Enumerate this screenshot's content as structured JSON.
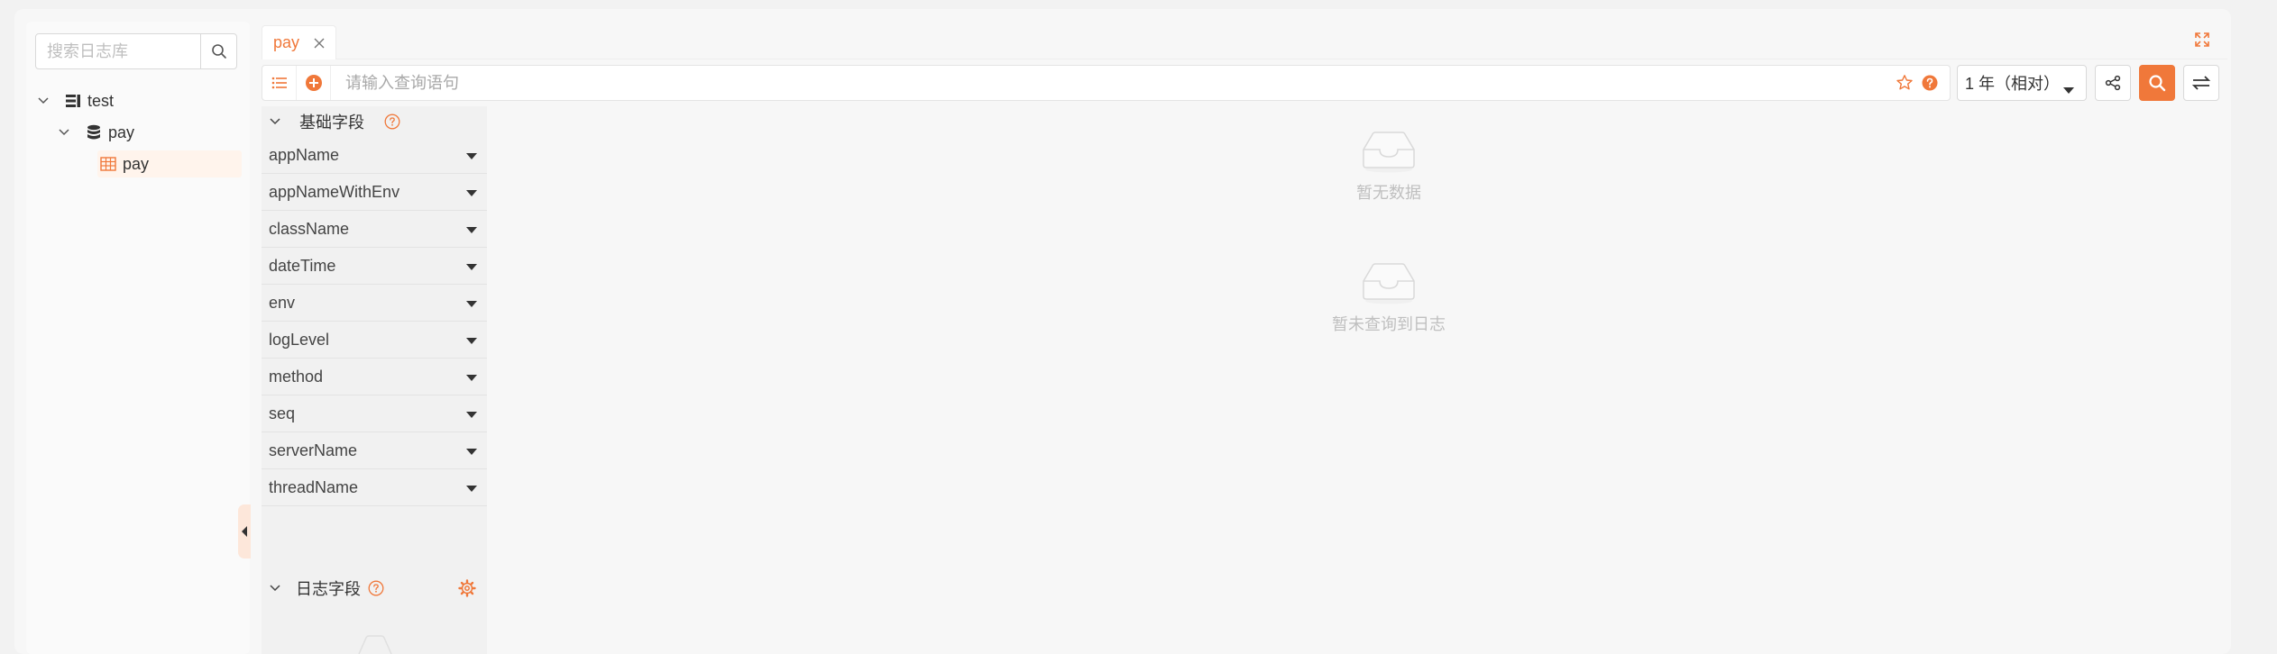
{
  "sidebar": {
    "search_placeholder": "搜索日志库",
    "tree": [
      {
        "label": "test",
        "level": 0
      },
      {
        "label": "pay",
        "level": 1
      },
      {
        "label": "pay",
        "level": 2,
        "selected": true
      }
    ]
  },
  "tabs": [
    {
      "label": "pay",
      "active": true
    }
  ],
  "query": {
    "placeholder": "请输入查询语句"
  },
  "time_range": {
    "value": "1 年（相对）"
  },
  "fields": {
    "basic_title": "基础字段",
    "basic_items": [
      "appName",
      "appNameWithEnv",
      "className",
      "dateTime",
      "env",
      "logLevel",
      "method",
      "seq",
      "serverName",
      "threadName"
    ],
    "log_title": "日志字段"
  },
  "results": {
    "chart_empty": "暂无数据",
    "logs_empty": "暂未查询到日志"
  },
  "colors": {
    "accent": "#f0783a"
  }
}
